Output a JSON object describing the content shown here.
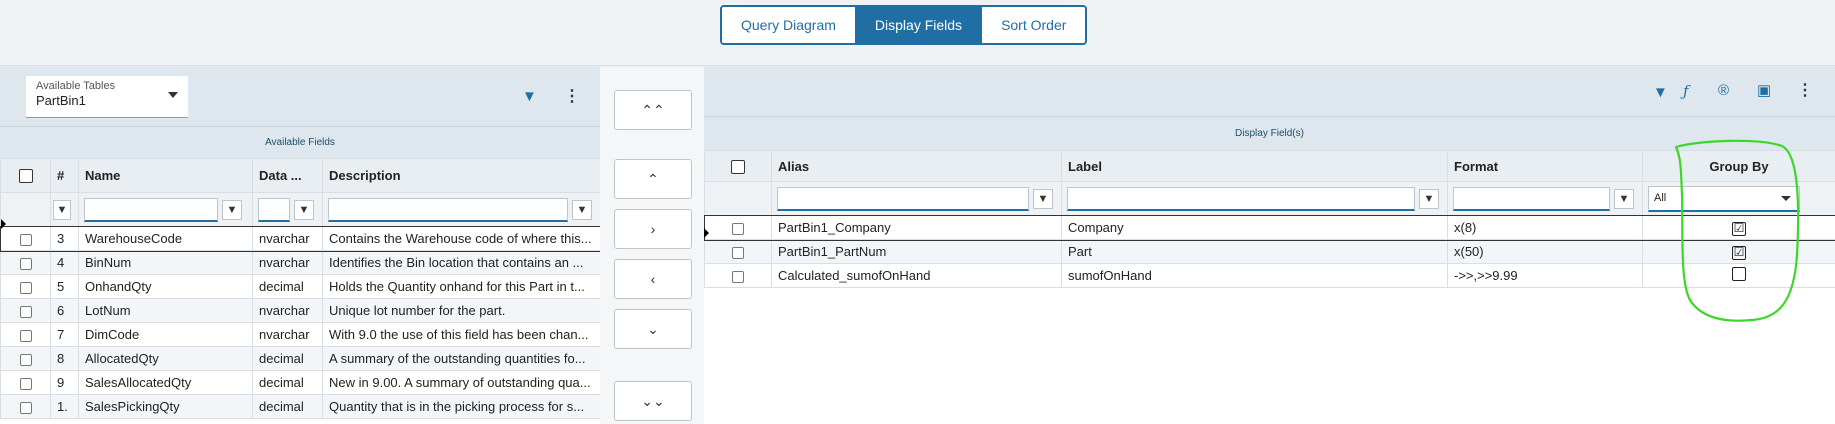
{
  "tabs": [
    "Query Diagram",
    "Display Fields",
    "Sort Order"
  ],
  "active_tab": 1,
  "left": {
    "selector_label": "Available Tables",
    "selector_value": "PartBin1",
    "section_title": "Available Fields",
    "columns": [
      "#",
      "Name",
      "Data ...",
      "Description"
    ],
    "rows": [
      {
        "num": "3",
        "name": "WarehouseCode",
        "type": "nvarchar",
        "desc": "Contains the Warehouse code of where this..."
      },
      {
        "num": "4",
        "name": "BinNum",
        "type": "nvarchar",
        "desc": "Identifies the Bin location that contains an ..."
      },
      {
        "num": "5",
        "name": "OnhandQty",
        "type": "decimal",
        "desc": "Holds the Quantity onhand for this Part in t..."
      },
      {
        "num": "6",
        "name": "LotNum",
        "type": "nvarchar",
        "desc": "Unique lot number for the part."
      },
      {
        "num": "7",
        "name": "DimCode",
        "type": "nvarchar",
        "desc": "With 9.0 the use of this field has been chan..."
      },
      {
        "num": "8",
        "name": "AllocatedQty",
        "type": "decimal",
        "desc": "A summary of the outstanding quantities fo..."
      },
      {
        "num": "9",
        "name": "SalesAllocatedQty",
        "type": "decimal",
        "desc": "New in 9.00. A summary of outstanding qua..."
      },
      {
        "num": "1.",
        "name": "SalesPickingQty",
        "type": "decimal",
        "desc": "Quantity that is in the picking process for s..."
      }
    ]
  },
  "middle_buttons": [
    "«",
    "‹",
    "›",
    "‹",
    "‹",
    "«"
  ],
  "right": {
    "section_title": "Display Field(s)",
    "columns": [
      "Alias",
      "Label",
      "Format",
      "Group By"
    ],
    "group_filter": "All",
    "rows": [
      {
        "alias": "PartBin1_Company",
        "label": "Company",
        "format": "x(8)",
        "group": "☑"
      },
      {
        "alias": "PartBin1_PartNum",
        "label": "Part",
        "format": "x(50)",
        "group": "☑"
      },
      {
        "alias": "Calculated_sumofOnHand",
        "label": "sumofOnHand",
        "format": "->>,>>9.99",
        "group": ""
      }
    ]
  },
  "icons": {
    "filter": "filter-icon",
    "more": "kebab-icon",
    "function": "function-icon",
    "registered": "r-icon",
    "layout": "layout-icon"
  },
  "colors": {
    "accent": "#1f6fa5",
    "annotation": "#3fd62b"
  }
}
